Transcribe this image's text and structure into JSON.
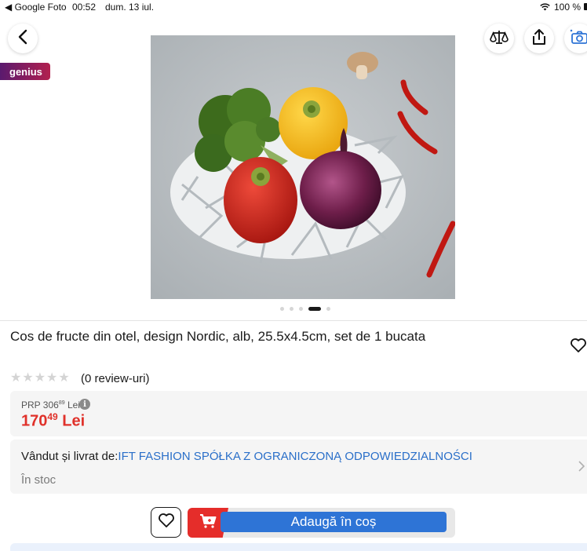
{
  "status_bar": {
    "back_app": "◀ Google Foto",
    "time": "00:52",
    "date": "dum. 13 iul.",
    "battery": "100 %"
  },
  "header": {
    "back_icon": "chevron-left-icon",
    "compare_icon": "scale-icon",
    "share_icon": "share-icon",
    "camera_icon": "camera-search-icon"
  },
  "badge": {
    "label": "genius"
  },
  "gallery": {
    "image_count": 5,
    "active_index": 3
  },
  "product": {
    "title": "Cos de fructe din otel, design Nordic, alb, 25.5x4.5cm, set de 1 bucata",
    "rating_stars": 0,
    "reviews": "(0 review-uri)"
  },
  "price": {
    "prp_label": "PRP 306",
    "prp_decimals": "89",
    "prp_currency": "Lei",
    "price_int": "170",
    "price_decimals": "49",
    "currency": "Lei"
  },
  "seller": {
    "label": "Vândut și livrat de:",
    "name": "IFT FASHION SPÓŁKA Z OGRANICZONĄ ODPOWIEDZIALNOŚCI",
    "stock": "În stoc"
  },
  "actions": {
    "add_to_cart": "Adaugă în coș"
  },
  "colors": {
    "accent_red": "#e52d2a",
    "button_blue": "#2e74d6",
    "link_blue": "#2a6fc9",
    "genius_gradient_start": "#5a1a6e",
    "genius_gradient_end": "#b2204f"
  }
}
